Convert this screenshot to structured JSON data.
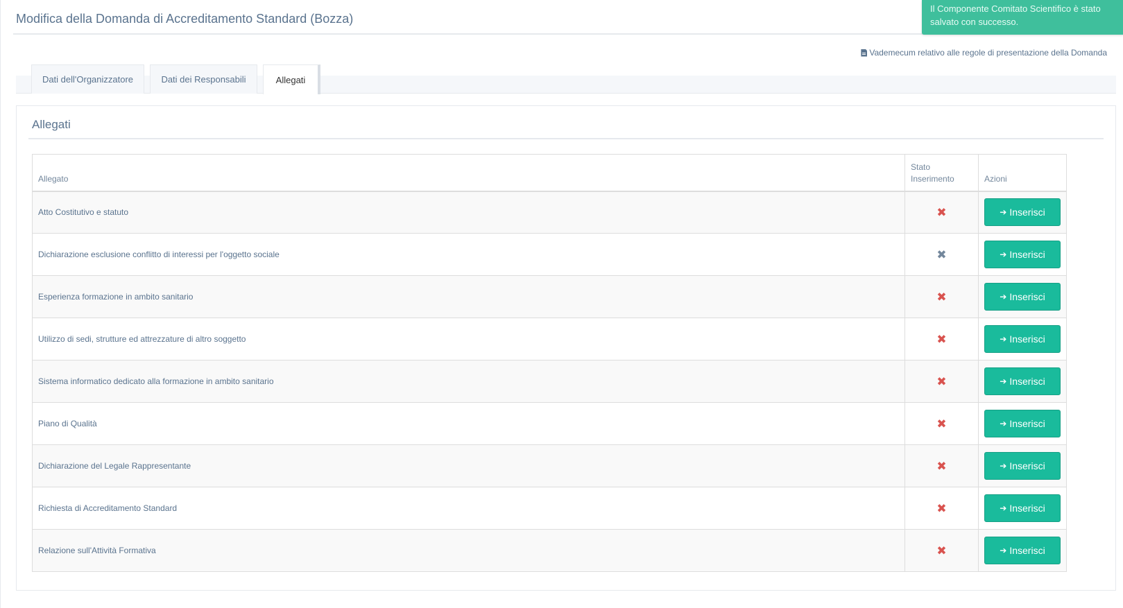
{
  "page": {
    "title": "Modifica della Domanda di Accreditamento Standard (Bozza)"
  },
  "notification": {
    "text": "Il Componente Comitato Scientifico è stato salvato con successo."
  },
  "vademecum": {
    "icon": "file-text-icon",
    "label": "Vademecum relativo alle regole di presentazione della Domanda"
  },
  "tabs": [
    {
      "label": "Dati dell'Organizzatore",
      "active": false
    },
    {
      "label": "Dati dei Responsabili",
      "active": false
    },
    {
      "label": "Allegati",
      "active": true
    }
  ],
  "panel": {
    "title": "Allegati",
    "columns": {
      "allegato": "Allegato",
      "stato_line1": "Stato",
      "stato_line2": "Inserimento",
      "azioni": "Azioni"
    },
    "button_label": "Inserisci",
    "button_icon": "sign-in-icon",
    "status_icon": "times-icon",
    "status_color_missing": "#d9534f",
    "status_color_optional": "#73879c",
    "rows": [
      {
        "allegato": "Atto Costitutivo e statuto",
        "status": "missing"
      },
      {
        "allegato": "Dichiarazione esclusione conflitto di interessi per l'oggetto sociale",
        "status": "optional"
      },
      {
        "allegato": "Esperienza formazione in ambito sanitario",
        "status": "missing"
      },
      {
        "allegato": "Utilizzo di sedi, strutture ed attrezzature di altro soggetto",
        "status": "missing"
      },
      {
        "allegato": "Sistema informatico dedicato alla formazione in ambito sanitario",
        "status": "missing"
      },
      {
        "allegato": "Piano di Qualità",
        "status": "missing"
      },
      {
        "allegato": "Dichiarazione del Legale Rappresentante",
        "status": "missing"
      },
      {
        "allegato": "Richiesta di Accreditamento Standard",
        "status": "missing"
      },
      {
        "allegato": "Relazione sull'Attività Formativa",
        "status": "missing"
      }
    ]
  },
  "colors": {
    "accent": "#1abb9c",
    "toast": "#3fbf9c",
    "text": "#5a738e"
  }
}
